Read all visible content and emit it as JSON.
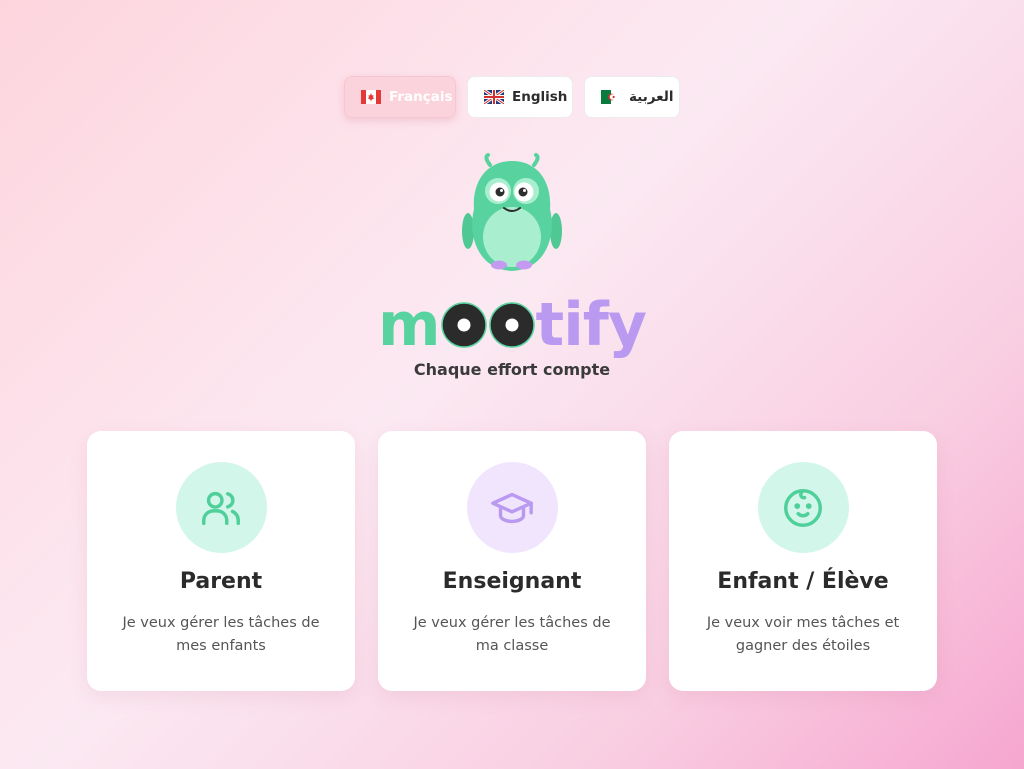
{
  "languages": [
    {
      "label": "Français",
      "flag": "canada-flag-icon",
      "active": true
    },
    {
      "label": "English",
      "flag": "uk-flag-icon",
      "active": false
    },
    {
      "label": "العربية",
      "flag": "algeria-flag-icon",
      "active": false
    }
  ],
  "brand": {
    "name_start": "m",
    "name_end": "tify",
    "tagline": "Chaque effort compte"
  },
  "cards": [
    {
      "icon": "users-icon",
      "title": "Parent",
      "description": "Je veux gérer les tâches de mes enfants"
    },
    {
      "icon": "graduation-cap-icon",
      "title": "Enseignant",
      "description": "Je veux gérer les tâches de ma classe"
    },
    {
      "icon": "child-face-icon",
      "title": "Enfant / Élève",
      "description": "Je veux voir mes tâches et gagner des étoiles"
    }
  ],
  "colors": {
    "mint": "#58d3a0",
    "lavender": "#b99af0",
    "background": "#fde3ec"
  }
}
